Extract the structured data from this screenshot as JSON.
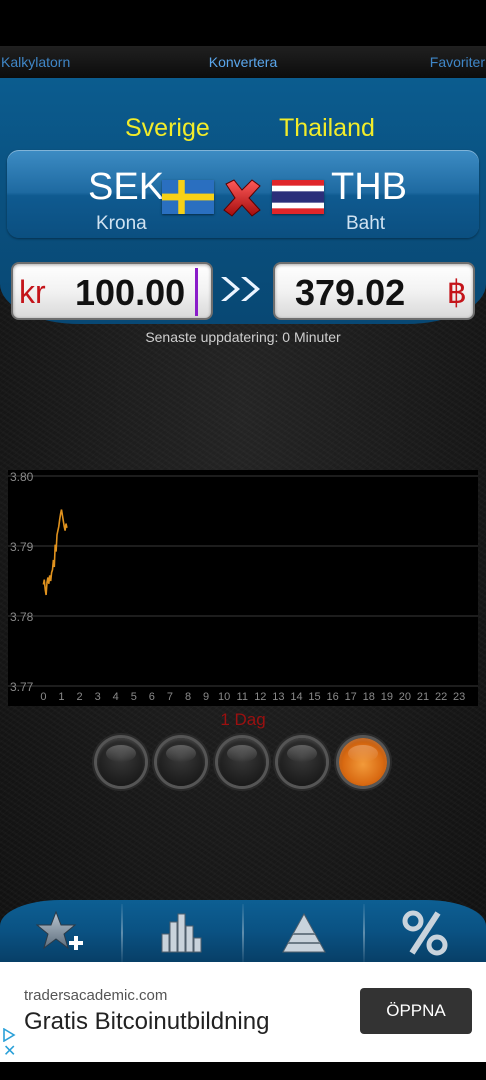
{
  "tabs": {
    "left": "Kalkylatorn",
    "center": "Konvertera",
    "right": "Favoriter"
  },
  "from": {
    "country": "Sverige",
    "code": "SEK",
    "name": "Krona",
    "symbol": "kr",
    "amount": "100.00"
  },
  "to": {
    "country": "Thailand",
    "code": "THB",
    "name": "Baht",
    "symbol": "฿",
    "amount": "379.02"
  },
  "last_update": "Senaste uppdatering: 0 Minuter",
  "period_label": "1 Dag",
  "period_buttons": [
    "period-1",
    "period-2",
    "period-3",
    "period-4",
    "period-5"
  ],
  "active_period_index": 4,
  "toolbar": [
    "add-favorite-icon",
    "chart-icon",
    "pyramid-icon",
    "percent-icon"
  ],
  "colors": {
    "panel_blue": "#0a4f7d",
    "country_yellow": "#f2ec2a",
    "line_orange": "#e0921e",
    "period_red": "#9c1010"
  },
  "chart_data": {
    "type": "line",
    "x_ticks": [
      "0",
      "1",
      "2",
      "3",
      "4",
      "5",
      "6",
      "7",
      "8",
      "9",
      "10",
      "11",
      "12",
      "13",
      "14",
      "15",
      "16",
      "17",
      "18",
      "19",
      "20",
      "21",
      "22",
      "23"
    ],
    "y_ticks": [
      "3.80",
      "3.79",
      "3.78",
      "3.77"
    ],
    "ylim": [
      3.77,
      3.8
    ],
    "xlim": [
      -0.3,
      23.6
    ],
    "grid": true,
    "series": [
      {
        "x": [
          0.0,
          0.05,
          0.1,
          0.15,
          0.2,
          0.25,
          0.3,
          0.35,
          0.4,
          0.45,
          0.5,
          0.55,
          0.6,
          0.65,
          0.7,
          0.75,
          0.8,
          0.85,
          0.9,
          0.95,
          1.0,
          1.05,
          1.1,
          1.15,
          1.2,
          1.25,
          1.3
        ],
        "y": [
          3.7845,
          3.7852,
          3.7838,
          3.783,
          3.7848,
          3.7855,
          3.7846,
          3.7858,
          3.785,
          3.7862,
          3.7866,
          3.788,
          3.787,
          3.7902,
          3.7892,
          3.7916,
          3.7922,
          3.7928,
          3.7938,
          3.7946,
          3.7952,
          3.7944,
          3.7936,
          3.7928,
          3.7922,
          3.7932,
          3.7926
        ]
      }
    ]
  },
  "ad": {
    "domain": "tradersacademic.com",
    "title": "Gratis Bitcoinutbildning",
    "button": "ÖPPNA",
    "close": "✕"
  }
}
